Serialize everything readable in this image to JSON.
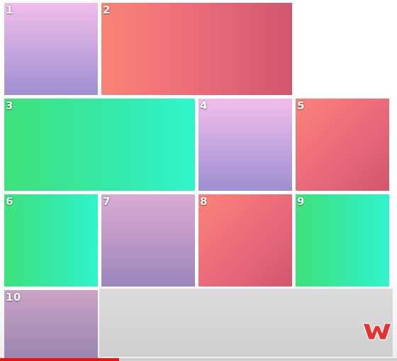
{
  "tiles": [
    {
      "label": "1"
    },
    {
      "label": "2"
    },
    {
      "label": "3"
    },
    {
      "label": "4"
    },
    {
      "label": "5"
    },
    {
      "label": "6"
    },
    {
      "label": "7"
    },
    {
      "label": "8"
    },
    {
      "label": "9"
    },
    {
      "label": "10"
    }
  ],
  "colors": {
    "purple_top": "#f1bde9",
    "purple_bottom": "#9e8fd0",
    "red_left": "#fb8378",
    "red_right": "#d2566d",
    "green_left": "#3fe27b",
    "green_right": "#31f4cd",
    "logo_red": "#e8322f",
    "progress_red": "#ee1111"
  },
  "logo": {
    "icon": "w-logo-icon"
  },
  "video_progress": {
    "fraction": 0.3
  }
}
